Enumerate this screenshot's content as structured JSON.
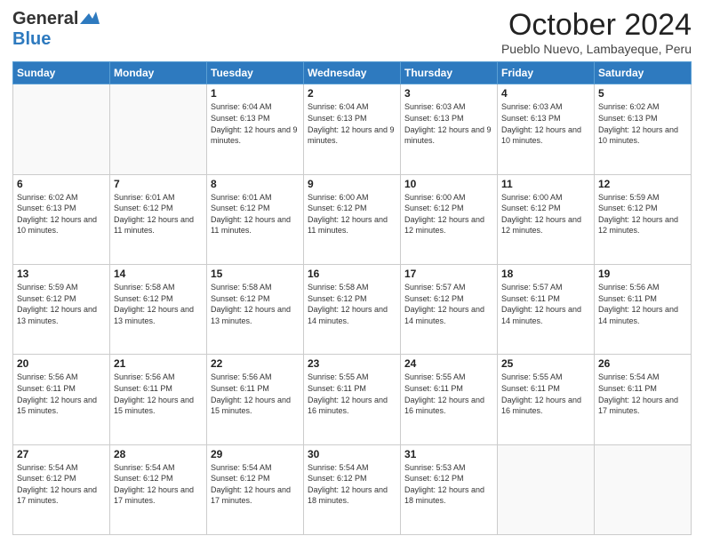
{
  "header": {
    "logo_general": "General",
    "logo_blue": "Blue",
    "month_title": "October 2024",
    "subtitle": "Pueblo Nuevo, Lambayeque, Peru"
  },
  "days_of_week": [
    "Sunday",
    "Monday",
    "Tuesday",
    "Wednesday",
    "Thursday",
    "Friday",
    "Saturday"
  ],
  "weeks": [
    [
      {
        "day": "",
        "info": ""
      },
      {
        "day": "",
        "info": ""
      },
      {
        "day": "1",
        "info": "Sunrise: 6:04 AM\nSunset: 6:13 PM\nDaylight: 12 hours and 9 minutes."
      },
      {
        "day": "2",
        "info": "Sunrise: 6:04 AM\nSunset: 6:13 PM\nDaylight: 12 hours and 9 minutes."
      },
      {
        "day": "3",
        "info": "Sunrise: 6:03 AM\nSunset: 6:13 PM\nDaylight: 12 hours and 9 minutes."
      },
      {
        "day": "4",
        "info": "Sunrise: 6:03 AM\nSunset: 6:13 PM\nDaylight: 12 hours and 10 minutes."
      },
      {
        "day": "5",
        "info": "Sunrise: 6:02 AM\nSunset: 6:13 PM\nDaylight: 12 hours and 10 minutes."
      }
    ],
    [
      {
        "day": "6",
        "info": "Sunrise: 6:02 AM\nSunset: 6:13 PM\nDaylight: 12 hours and 10 minutes."
      },
      {
        "day": "7",
        "info": "Sunrise: 6:01 AM\nSunset: 6:12 PM\nDaylight: 12 hours and 11 minutes."
      },
      {
        "day": "8",
        "info": "Sunrise: 6:01 AM\nSunset: 6:12 PM\nDaylight: 12 hours and 11 minutes."
      },
      {
        "day": "9",
        "info": "Sunrise: 6:00 AM\nSunset: 6:12 PM\nDaylight: 12 hours and 11 minutes."
      },
      {
        "day": "10",
        "info": "Sunrise: 6:00 AM\nSunset: 6:12 PM\nDaylight: 12 hours and 12 minutes."
      },
      {
        "day": "11",
        "info": "Sunrise: 6:00 AM\nSunset: 6:12 PM\nDaylight: 12 hours and 12 minutes."
      },
      {
        "day": "12",
        "info": "Sunrise: 5:59 AM\nSunset: 6:12 PM\nDaylight: 12 hours and 12 minutes."
      }
    ],
    [
      {
        "day": "13",
        "info": "Sunrise: 5:59 AM\nSunset: 6:12 PM\nDaylight: 12 hours and 13 minutes."
      },
      {
        "day": "14",
        "info": "Sunrise: 5:58 AM\nSunset: 6:12 PM\nDaylight: 12 hours and 13 minutes."
      },
      {
        "day": "15",
        "info": "Sunrise: 5:58 AM\nSunset: 6:12 PM\nDaylight: 12 hours and 13 minutes."
      },
      {
        "day": "16",
        "info": "Sunrise: 5:58 AM\nSunset: 6:12 PM\nDaylight: 12 hours and 14 minutes."
      },
      {
        "day": "17",
        "info": "Sunrise: 5:57 AM\nSunset: 6:12 PM\nDaylight: 12 hours and 14 minutes."
      },
      {
        "day": "18",
        "info": "Sunrise: 5:57 AM\nSunset: 6:11 PM\nDaylight: 12 hours and 14 minutes."
      },
      {
        "day": "19",
        "info": "Sunrise: 5:56 AM\nSunset: 6:11 PM\nDaylight: 12 hours and 14 minutes."
      }
    ],
    [
      {
        "day": "20",
        "info": "Sunrise: 5:56 AM\nSunset: 6:11 PM\nDaylight: 12 hours and 15 minutes."
      },
      {
        "day": "21",
        "info": "Sunrise: 5:56 AM\nSunset: 6:11 PM\nDaylight: 12 hours and 15 minutes."
      },
      {
        "day": "22",
        "info": "Sunrise: 5:56 AM\nSunset: 6:11 PM\nDaylight: 12 hours and 15 minutes."
      },
      {
        "day": "23",
        "info": "Sunrise: 5:55 AM\nSunset: 6:11 PM\nDaylight: 12 hours and 16 minutes."
      },
      {
        "day": "24",
        "info": "Sunrise: 5:55 AM\nSunset: 6:11 PM\nDaylight: 12 hours and 16 minutes."
      },
      {
        "day": "25",
        "info": "Sunrise: 5:55 AM\nSunset: 6:11 PM\nDaylight: 12 hours and 16 minutes."
      },
      {
        "day": "26",
        "info": "Sunrise: 5:54 AM\nSunset: 6:11 PM\nDaylight: 12 hours and 17 minutes."
      }
    ],
    [
      {
        "day": "27",
        "info": "Sunrise: 5:54 AM\nSunset: 6:12 PM\nDaylight: 12 hours and 17 minutes."
      },
      {
        "day": "28",
        "info": "Sunrise: 5:54 AM\nSunset: 6:12 PM\nDaylight: 12 hours and 17 minutes."
      },
      {
        "day": "29",
        "info": "Sunrise: 5:54 AM\nSunset: 6:12 PM\nDaylight: 12 hours and 17 minutes."
      },
      {
        "day": "30",
        "info": "Sunrise: 5:54 AM\nSunset: 6:12 PM\nDaylight: 12 hours and 18 minutes."
      },
      {
        "day": "31",
        "info": "Sunrise: 5:53 AM\nSunset: 6:12 PM\nDaylight: 12 hours and 18 minutes."
      },
      {
        "day": "",
        "info": ""
      },
      {
        "day": "",
        "info": ""
      }
    ]
  ]
}
